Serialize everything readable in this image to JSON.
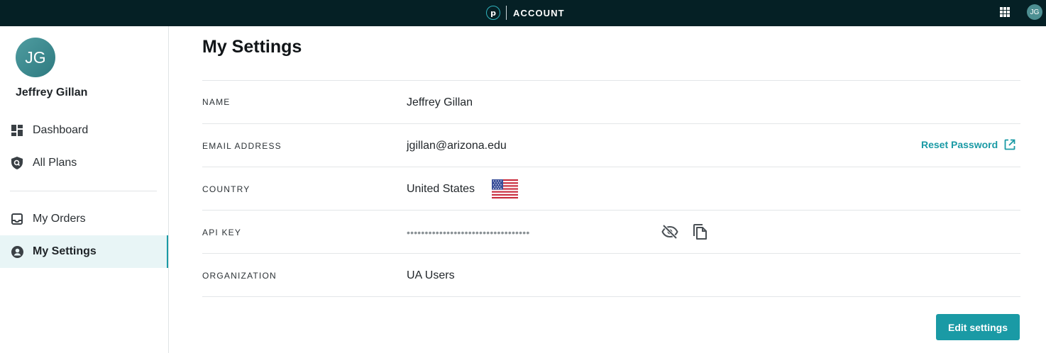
{
  "topbar": {
    "logo_letter": "p",
    "app_title": "ACCOUNT",
    "avatar_initials": "JG"
  },
  "sidebar": {
    "avatar_initials": "JG",
    "user_name": "Jeffrey Gillan",
    "items": [
      {
        "label": "Dashboard",
        "icon": "dashboard-icon",
        "active": false
      },
      {
        "label": "All Plans",
        "icon": "shield-icon",
        "active": false
      },
      {
        "label": "My Orders",
        "icon": "inbox-icon",
        "active": false
      },
      {
        "label": "My Settings",
        "icon": "account-circle-icon",
        "active": true
      }
    ]
  },
  "main": {
    "title": "My Settings",
    "rows": {
      "name": {
        "label": "NAME",
        "value": "Jeffrey Gillan"
      },
      "email": {
        "label": "EMAIL ADDRESS",
        "value": "jgillan@arizona.edu",
        "action": "Reset Password"
      },
      "country": {
        "label": "COUNTRY",
        "value": "United States",
        "flag": "us-flag-icon"
      },
      "api_key": {
        "label": "API KEY",
        "value": "••••••••••••••••••••••••••••••••••"
      },
      "organization": {
        "label": "ORGANIZATION",
        "value": "UA Users"
      }
    },
    "edit_button": "Edit settings"
  },
  "colors": {
    "topbar_bg": "#052025",
    "accent": "#1a9aa5",
    "active_nav_bg": "#e8f5f6",
    "avatar": "#3e8d92"
  }
}
